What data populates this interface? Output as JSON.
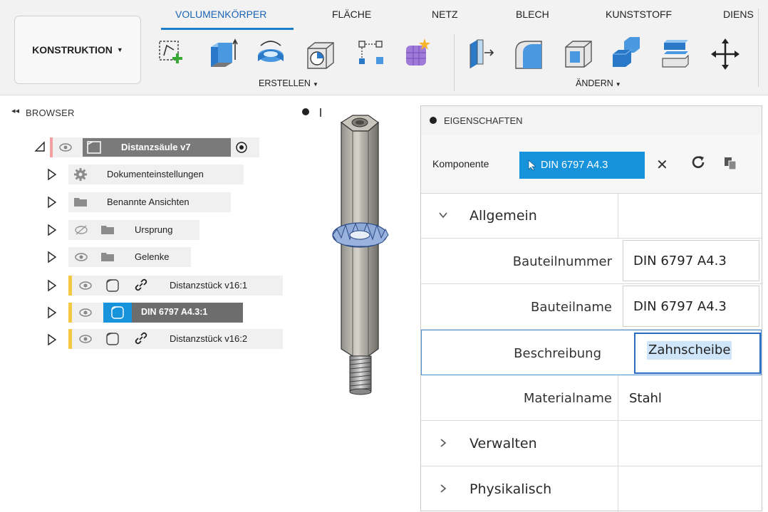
{
  "toolbar": {
    "workspace": "KONSTRUKTION",
    "tabs": [
      "VOLUMENKÖRPER",
      "FLÄCHE",
      "NETZ",
      "BLECH",
      "KUNSTSTOFF",
      "DIENS"
    ],
    "groups": {
      "create": "ERSTELLEN",
      "modify": "ÄNDERN"
    },
    "tools": [
      "create-sketch-icon",
      "extrude-icon",
      "revolve-icon",
      "hole-icon",
      "pattern-icon",
      "create-form-icon",
      "press-pull-icon",
      "fillet-icon",
      "shell-icon",
      "combine-icon",
      "offset-face-icon",
      "move-icon"
    ],
    "accent_color": "#1a7fc8"
  },
  "browser": {
    "title": "BROWSER",
    "root": "Distanzsäule v7",
    "items": [
      {
        "label": "Dokumenteinstellungen",
        "icon": "gear-icon"
      },
      {
        "label": "Benannte Ansichten",
        "icon": "folder-icon"
      },
      {
        "label": "Ursprung",
        "icon": "folder-icon",
        "hidden": true
      },
      {
        "label": "Gelenke",
        "icon": "folder-icon"
      },
      {
        "label": "Distanzstück v16:1",
        "icon": "component-icon",
        "linked": true
      },
      {
        "label": "DIN 6797 A4.3:1",
        "icon": "component-icon",
        "selected": true
      },
      {
        "label": "Distanzstück v16:2",
        "icon": "component-icon",
        "linked": true
      }
    ]
  },
  "properties": {
    "title": "EIGENSCHAFTEN",
    "component_label": "Komponente",
    "selected_component": "DIN 6797 A4.3",
    "sections": {
      "general": "Allgemein",
      "manage": "Verwalten",
      "physical": "Physikalisch"
    },
    "fields": {
      "part_number_label": "Bauteilnummer",
      "part_number_value": "DIN 6797 A4.3",
      "part_name_label": "Bauteilname",
      "part_name_value": "DIN 6797 A4.3",
      "description_label": "Beschreibung",
      "description_value": "Zahnscheibe",
      "material_label": "Materialname",
      "material_value": "Stahl"
    },
    "selection_color": "#1793dc"
  }
}
